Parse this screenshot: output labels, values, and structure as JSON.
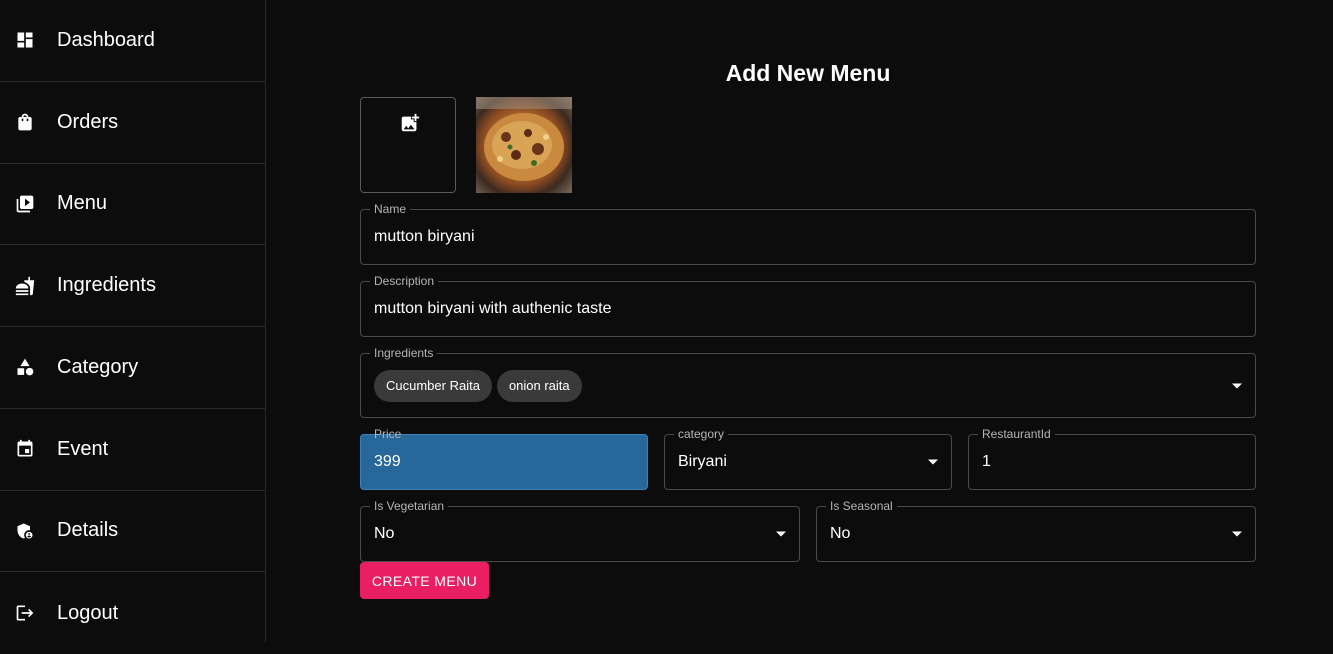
{
  "sidebar": {
    "items": [
      {
        "label": "Dashboard",
        "icon": "dashboard-icon"
      },
      {
        "label": "Orders",
        "icon": "shopping-bag-icon"
      },
      {
        "label": "Menu",
        "icon": "menu-book-icon"
      },
      {
        "label": "Ingredients",
        "icon": "fastfood-icon"
      },
      {
        "label": "Category",
        "icon": "category-icon"
      },
      {
        "label": "Event",
        "icon": "calendar-icon"
      },
      {
        "label": "Details",
        "icon": "admin-panel-icon"
      },
      {
        "label": "Logout",
        "icon": "logout-icon"
      }
    ]
  },
  "form": {
    "title": "Add New Menu",
    "upload_icon": "add-photo-icon",
    "name": {
      "label": "Name",
      "value": "mutton biryani"
    },
    "description": {
      "label": "Description",
      "value": "mutton biryani with authenic taste"
    },
    "ingredients": {
      "label": "Ingredients",
      "chips": [
        "Cucumber Raita",
        "onion raita"
      ]
    },
    "price": {
      "label": "Price",
      "value": "399"
    },
    "category": {
      "label": "category",
      "value": "Biryani"
    },
    "restaurant_id": {
      "label": "RestaurantId",
      "value": "1"
    },
    "is_vegetarian": {
      "label": "Is Vegetarian",
      "value": "No"
    },
    "is_seasonal": {
      "label": "Is Seasonal",
      "value": "No"
    },
    "submit_label": "CREATE MENU"
  },
  "colors": {
    "background": "#0c0c0c",
    "accent": "#e91e63",
    "focused_field": "#276799"
  }
}
